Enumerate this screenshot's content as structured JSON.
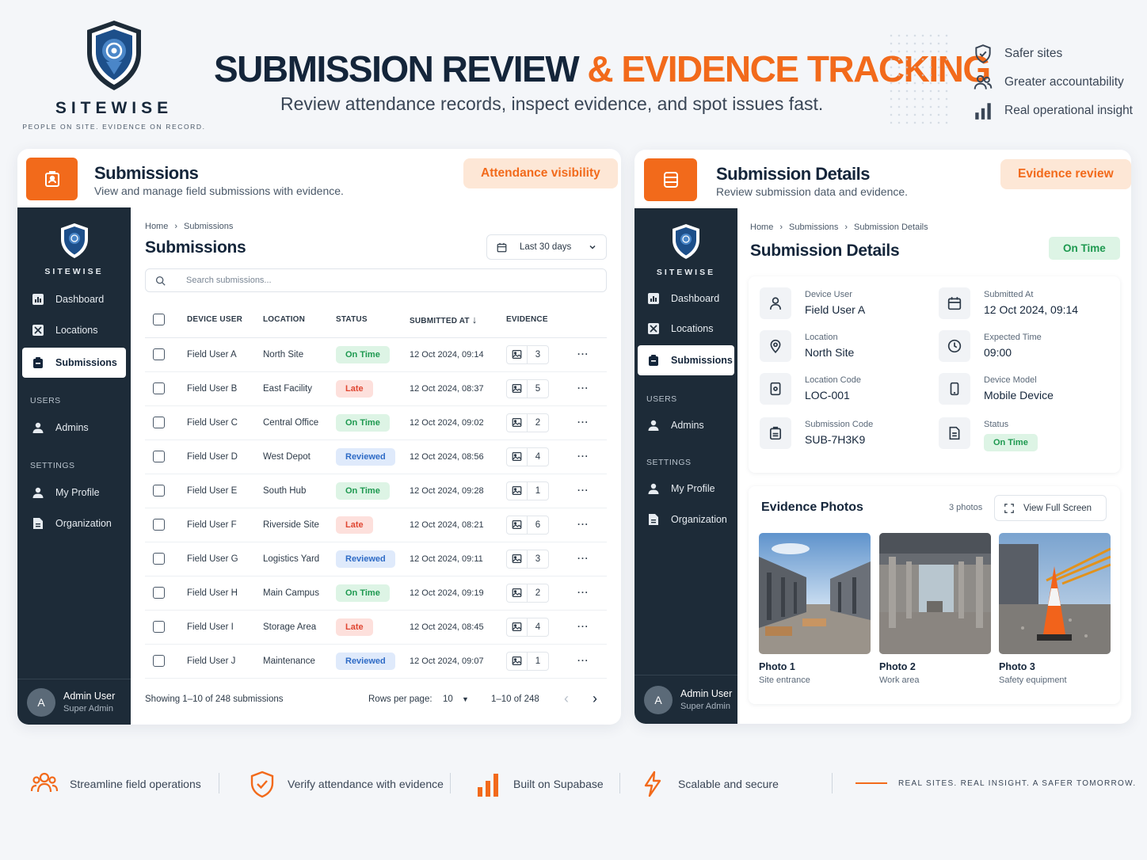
{
  "brand": {
    "name": "SITEWISE",
    "tagline": "PEOPLE ON SITE. EVIDENCE ON RECORD."
  },
  "hero": {
    "title_a": "SUBMISSION REVIEW",
    "title_b": "& EVIDENCE TRACKING",
    "subtitle": "Review attendance records, inspect evidence, and spot issues fast."
  },
  "benefits": [
    "Safer sites",
    "Greater accountability",
    "Real operational insight"
  ],
  "left_panel": {
    "title": "Submissions",
    "subtitle": "View and manage field submissions with evidence.",
    "pill": "Attendance visibility",
    "breadcrumb": [
      "Home",
      "Submissions"
    ],
    "heading": "Submissions",
    "date_filter": "Last 30 days",
    "search_placeholder": "Search submissions...",
    "columns": [
      "DEVICE USER",
      "LOCATION",
      "STATUS",
      "SUBMITTED AT",
      "EVIDENCE"
    ],
    "rows": [
      {
        "user": "Field User A",
        "location": "North Site",
        "status": "On Time",
        "submitted": "12 Oct 2024, 09:14",
        "evidence": "3"
      },
      {
        "user": "Field User B",
        "location": "East Facility",
        "status": "Late",
        "submitted": "12 Oct 2024, 08:37",
        "evidence": "5"
      },
      {
        "user": "Field User C",
        "location": "Central Office",
        "status": "On Time",
        "submitted": "12 Oct 2024, 09:02",
        "evidence": "2"
      },
      {
        "user": "Field User D",
        "location": "West Depot",
        "status": "Reviewed",
        "submitted": "12 Oct 2024, 08:56",
        "evidence": "4"
      },
      {
        "user": "Field User E",
        "location": "South Hub",
        "status": "On Time",
        "submitted": "12 Oct 2024, 09:28",
        "evidence": "1"
      },
      {
        "user": "Field User F",
        "location": "Riverside Site",
        "status": "Late",
        "submitted": "12 Oct 2024, 08:21",
        "evidence": "6"
      },
      {
        "user": "Field User G",
        "location": "Logistics Yard",
        "status": "Reviewed",
        "submitted": "12 Oct 2024, 09:11",
        "evidence": "3"
      },
      {
        "user": "Field User H",
        "location": "Main Campus",
        "status": "On Time",
        "submitted": "12 Oct 2024, 09:19",
        "evidence": "2"
      },
      {
        "user": "Field User I",
        "location": "Storage Area",
        "status": "Late",
        "submitted": "12 Oct 2024, 08:45",
        "evidence": "4"
      },
      {
        "user": "Field User J",
        "location": "Maintenance",
        "status": "Reviewed",
        "submitted": "12 Oct 2024, 09:07",
        "evidence": "1"
      }
    ],
    "showing": "Showing 1–10 of 248 submissions",
    "rows_per_page_label": "Rows per page:",
    "rows_per_page": "10",
    "range": "1–10 of 248"
  },
  "sidebar": {
    "logo": "SITEWISE",
    "items": {
      "dashboard": "Dashboard",
      "locations": "Locations",
      "submissions": "Submissions",
      "admins": "Admins",
      "profile": "My Profile",
      "organization": "Organization"
    },
    "sections": {
      "users": "USERS",
      "settings": "SETTINGS"
    },
    "user_name": "Admin User",
    "user_role": "Super Admin",
    "avatar": "A"
  },
  "right_panel": {
    "title": "Submission Details",
    "subtitle": "Review submission data and evidence.",
    "pill": "Evidence review",
    "breadcrumb": [
      "Home",
      "Submissions",
      "Submission Details"
    ],
    "heading": "Submission Details",
    "status_badge": "On Time",
    "fields": {
      "device_user": {
        "label": "Device User",
        "value": "Field User A"
      },
      "submitted_at": {
        "label": "Submitted At",
        "value": "12 Oct 2024, 09:14"
      },
      "location": {
        "label": "Location",
        "value": "North Site"
      },
      "expected_time": {
        "label": "Expected Time",
        "value": "09:00"
      },
      "location_code": {
        "label": "Location Code",
        "value": "LOC-001"
      },
      "device_model": {
        "label": "Device Model",
        "value": "Mobile Device"
      },
      "submission_code": {
        "label": "Submission Code",
        "value": "SUB-7H3K9"
      },
      "status": {
        "label": "Status",
        "value": "On Time"
      }
    },
    "evidence": {
      "title": "Evidence Photos",
      "count": "3 photos",
      "fullscreen": "View Full Screen",
      "photos": [
        {
          "title": "Photo 1",
          "caption": "Site entrance"
        },
        {
          "title": "Photo 2",
          "caption": "Work area"
        },
        {
          "title": "Photo 3",
          "caption": "Safety equipment"
        }
      ]
    }
  },
  "footer": {
    "items": [
      "Streamline field operations",
      "Verify attendance with evidence",
      "Built on Supabase",
      "Scalable and secure"
    ],
    "slogan": "REAL SITES. REAL INSIGHT. A SAFER TOMORROW."
  },
  "colors": {
    "accent": "#f26a1b",
    "navy": "#1d2b38",
    "on_time": "#1e9950",
    "late": "#e04632",
    "reviewed": "#2e6bc6"
  }
}
